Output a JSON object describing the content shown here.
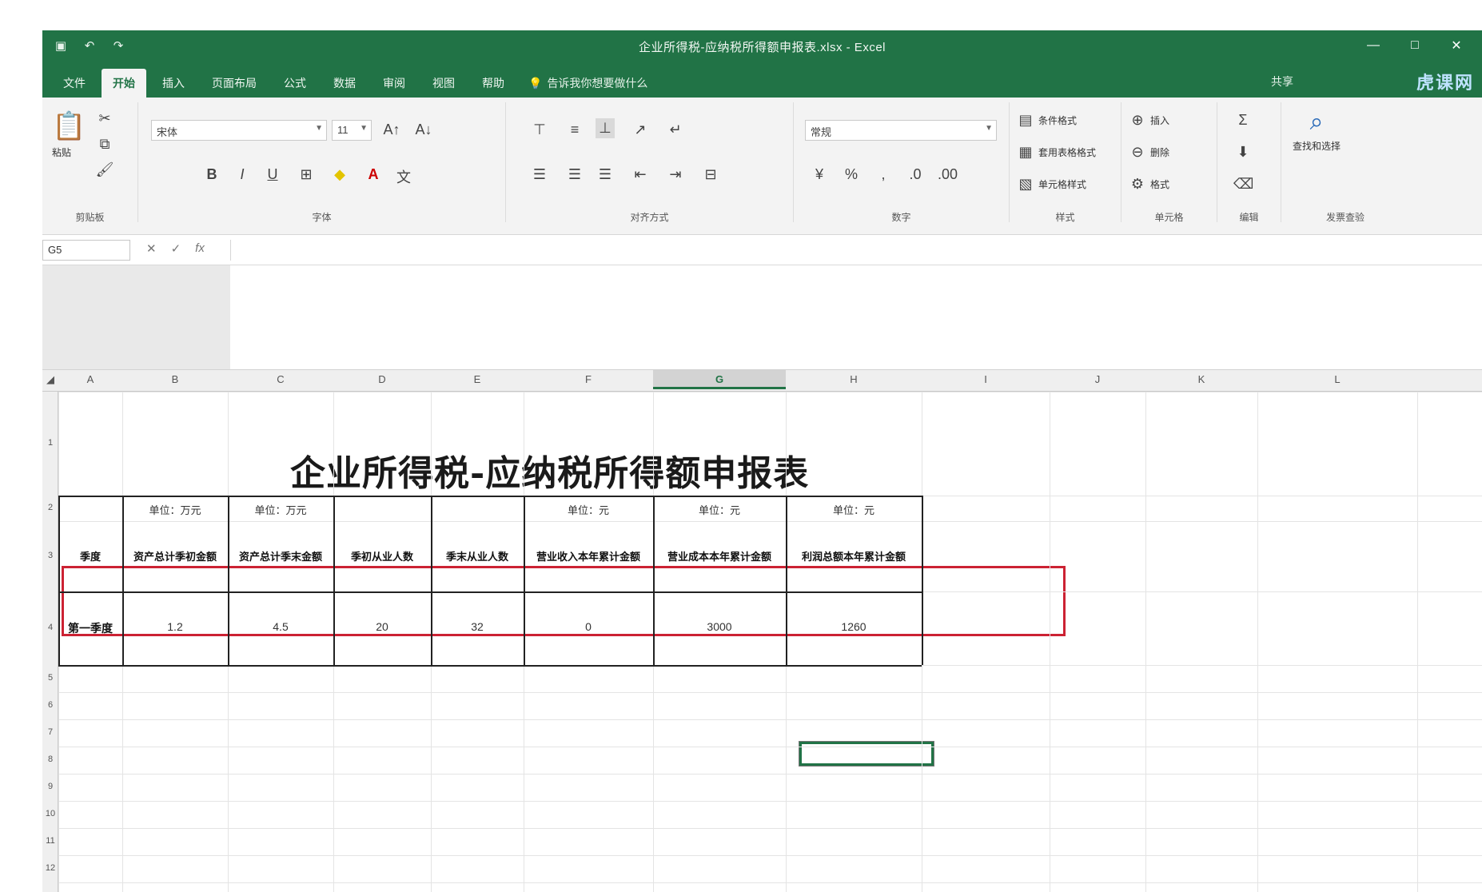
{
  "window": {
    "title": "企业所得税-应纳税所得额申报表.xlsx - Excel",
    "qat_icons": [
      "save-icon",
      "undo-icon",
      "redo-icon"
    ],
    "controls": {
      "minimize": "—",
      "maximize": "□",
      "close": "✕"
    }
  },
  "tabs": [
    {
      "label": "文件",
      "active": false
    },
    {
      "label": "开始",
      "active": true
    },
    {
      "label": "插入",
      "active": false
    },
    {
      "label": "页面布局",
      "active": false
    },
    {
      "label": "公式",
      "active": false
    },
    {
      "label": "数据",
      "active": false
    },
    {
      "label": "审阅",
      "active": false
    },
    {
      "label": "视图",
      "active": false
    },
    {
      "label": "帮助",
      "active": false
    }
  ],
  "tell_me": "告诉我你想要做什么",
  "share": "共享",
  "brand": "虎课网",
  "ribbon": {
    "clipboard": {
      "paste": "粘贴",
      "label": "剪贴板"
    },
    "font": {
      "name": "宋体",
      "size": "11",
      "label": "字体"
    },
    "alignment": {
      "label": "对齐方式"
    },
    "number": {
      "format": "常规",
      "label": "数字"
    },
    "styles": {
      "cond": "条件格式",
      "table": "套用表格格式",
      "cell": "单元格样式",
      "label": "样式"
    },
    "cells": {
      "insert": "插入",
      "delete": "删除",
      "format": "格式",
      "label": "单元格"
    },
    "editing": {
      "label": "编辑"
    },
    "search": {
      "label": "发票查验",
      "sub": "查找和选择"
    }
  },
  "formula_bar": {
    "name_box": "G5",
    "fx": "fx",
    "value": ""
  },
  "columns": [
    "A",
    "B",
    "C",
    "D",
    "E",
    "F",
    "G",
    "H",
    "I",
    "J",
    "K",
    "L"
  ],
  "selected_column": "G",
  "rows": [
    "1",
    "2",
    "3",
    "4",
    "5",
    "6",
    "7",
    "8",
    "9",
    "10",
    "11",
    "12"
  ],
  "sheet": {
    "title": "企业所得税-应纳税所得额申报表",
    "units": [
      "单位：万元",
      "单位：万元",
      "单位：元",
      "单位：元",
      "单位：元"
    ],
    "headers": [
      "季度",
      "资产总计季初金额",
      "资产总计季末金额",
      "季初从业人数",
      "季末从业人数",
      "营业收入本年累计金额",
      "营业成本本年累计金额",
      "利润总额本年累计金额"
    ],
    "row": [
      "第一季度",
      "1.2",
      "4.5",
      "20",
      "32",
      "0",
      "3000",
      "1260"
    ]
  }
}
